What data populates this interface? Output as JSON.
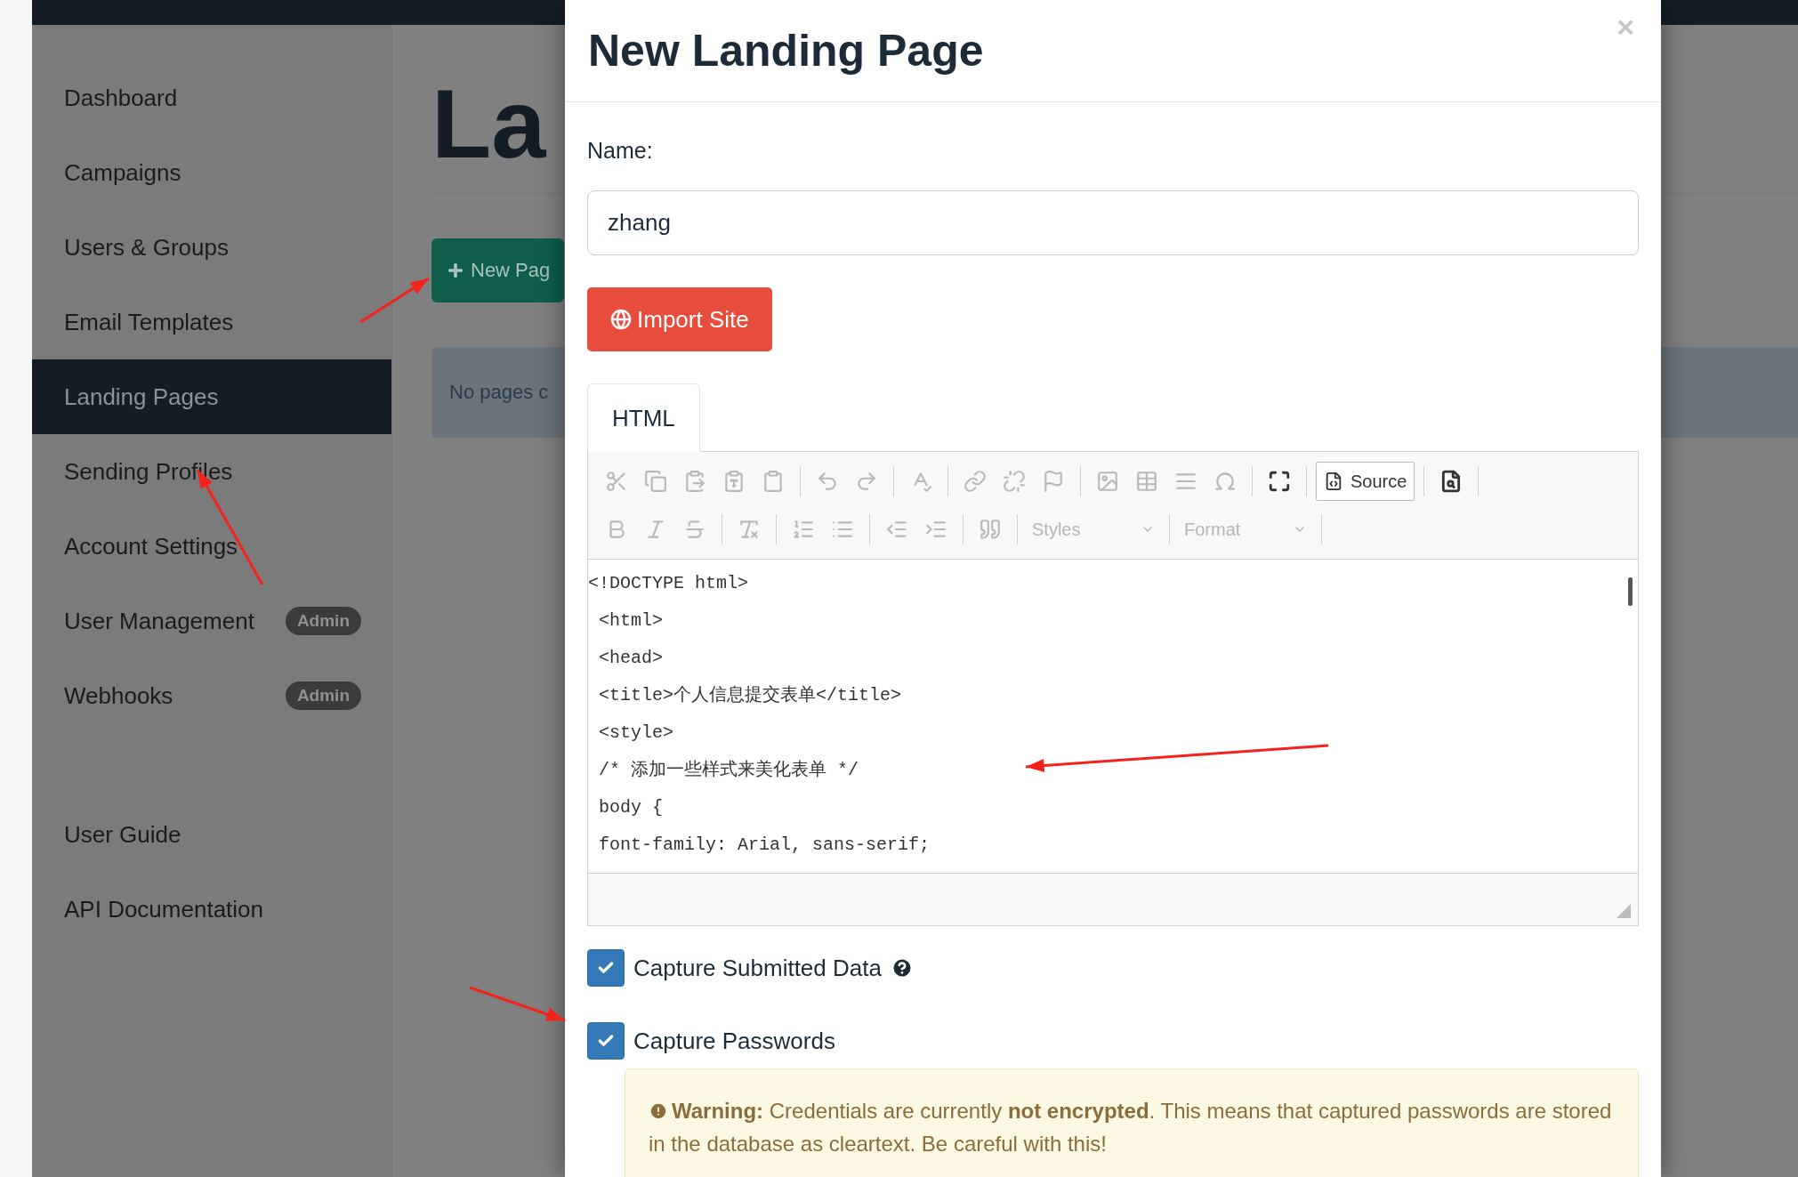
{
  "sidebar": {
    "items": [
      {
        "label": "Dashboard",
        "selected": false
      },
      {
        "label": "Campaigns",
        "selected": false
      },
      {
        "label": "Users & Groups",
        "selected": false
      },
      {
        "label": "Email Templates",
        "selected": false
      },
      {
        "label": "Landing Pages",
        "selected": true
      },
      {
        "label": "Sending Profiles",
        "selected": false
      },
      {
        "label": "Account Settings",
        "selected": false
      },
      {
        "label": "User Management",
        "selected": false,
        "badge": "Admin"
      },
      {
        "label": "Webhooks",
        "selected": false,
        "badge": "Admin"
      }
    ],
    "footer_items": [
      {
        "label": "User Guide"
      },
      {
        "label": "API Documentation"
      }
    ]
  },
  "main": {
    "title": "La",
    "new_button": "New Pag",
    "empty_message": "No pages c"
  },
  "modal": {
    "title": "New Landing Page",
    "close": "×",
    "name_label": "Name:",
    "name_value": "zhang",
    "import_button": "Import Site",
    "tabs": [
      {
        "label": "HTML",
        "selected": true
      }
    ],
    "toolbar": {
      "source_button": "Source",
      "styles": "Styles",
      "format": "Format"
    },
    "code_lines": [
      "<!DOCTYPE html>",
      " <html>",
      " <head>",
      " <title>个人信息提交表单</title>",
      " <style>",
      " /* 添加一些样式来美化表单 */",
      " body {",
      " font-family: Arial, sans-serif;"
    ],
    "options": [
      {
        "label": "Capture Submitted Data",
        "checked": true,
        "help": true
      },
      {
        "label": "Capture Passwords",
        "checked": true,
        "help": false
      }
    ],
    "warning": "**Warning:** Credentials are currently **not encrypted**. This means that captured passwords are stored in the database as cleartext. Be careful with this!"
  }
}
